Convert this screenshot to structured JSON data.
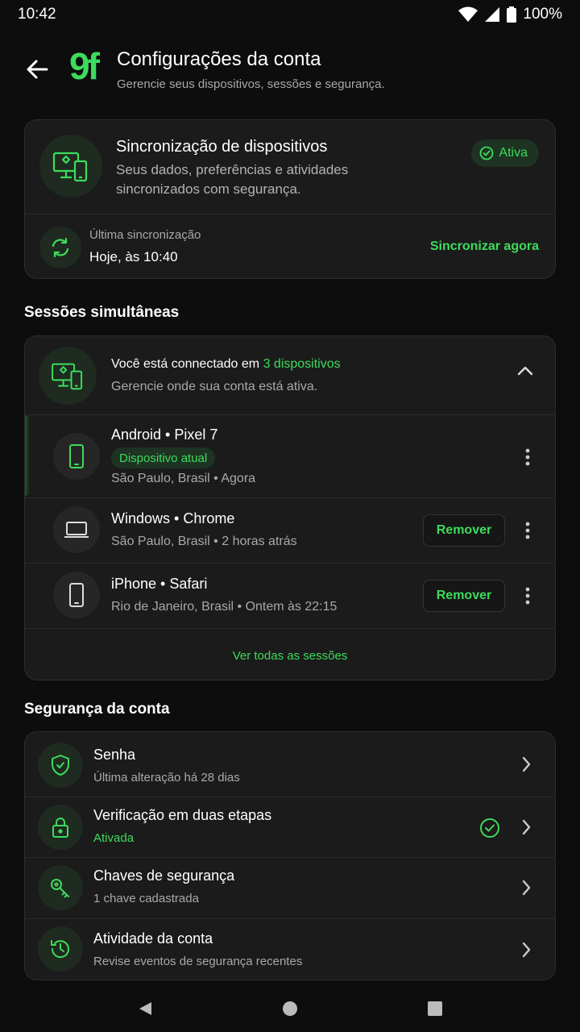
{
  "status_bar": {
    "time": "10:42",
    "battery": "100%"
  },
  "header": {
    "logo": "9f",
    "title": "Configurações da conta",
    "subtitle": "Gerencie seus dispositivos, sessões e segurança."
  },
  "sync": {
    "title": "Sincronização de dispositivos",
    "description": "Seus dados, preferências e atividades sincronizados com segurança.",
    "status": "Ativa",
    "last_sync_label": "Última sincronização",
    "last_sync_value": "Hoje, às 10:40",
    "sync_now": "Sincronizar agora"
  },
  "sessions": {
    "section_title": "Sessões simultâneas",
    "connected_prefix": "Você está connectado em ",
    "connected_count": "3 dispositivos",
    "manage_text": "Gerencie onde sua conta está ativa.",
    "items": [
      {
        "name": "Android • Pixel 7",
        "badge": "Dispositivo atual",
        "location": "São Paulo, Brasil • Agora",
        "icon": "phone-icon"
      },
      {
        "name": "Windows • Chrome",
        "location": "São Paulo, Brasil • 2 horas atrás",
        "action": "Remover",
        "icon": "laptop-icon"
      },
      {
        "name": "iPhone • Safari",
        "location": "Rio de Janeiro, Brasil • Ontem às 22:15",
        "action": "Remover",
        "icon": "phone-icon"
      }
    ],
    "see_all": "Ver todas as sessões"
  },
  "security": {
    "section_title": "Segurança da conta",
    "items": [
      {
        "title": "Senha",
        "subtitle": "Última alteração há 28 dias",
        "icon": "shield-icon"
      },
      {
        "title": "Verificação em duas etapas",
        "subtitle": "Ativada",
        "icon": "lock-icon"
      },
      {
        "title": "Chaves de segurança",
        "subtitle": "1 chave cadastrada",
        "icon": "key-icon"
      },
      {
        "title": "Atividade da conta",
        "subtitle": "Revise eventos de segurança recentes",
        "icon": "history-icon"
      }
    ]
  },
  "colors": {
    "accent": "#3ddc5c",
    "background": "#0d0d0d",
    "card": "#1b1b1b"
  }
}
